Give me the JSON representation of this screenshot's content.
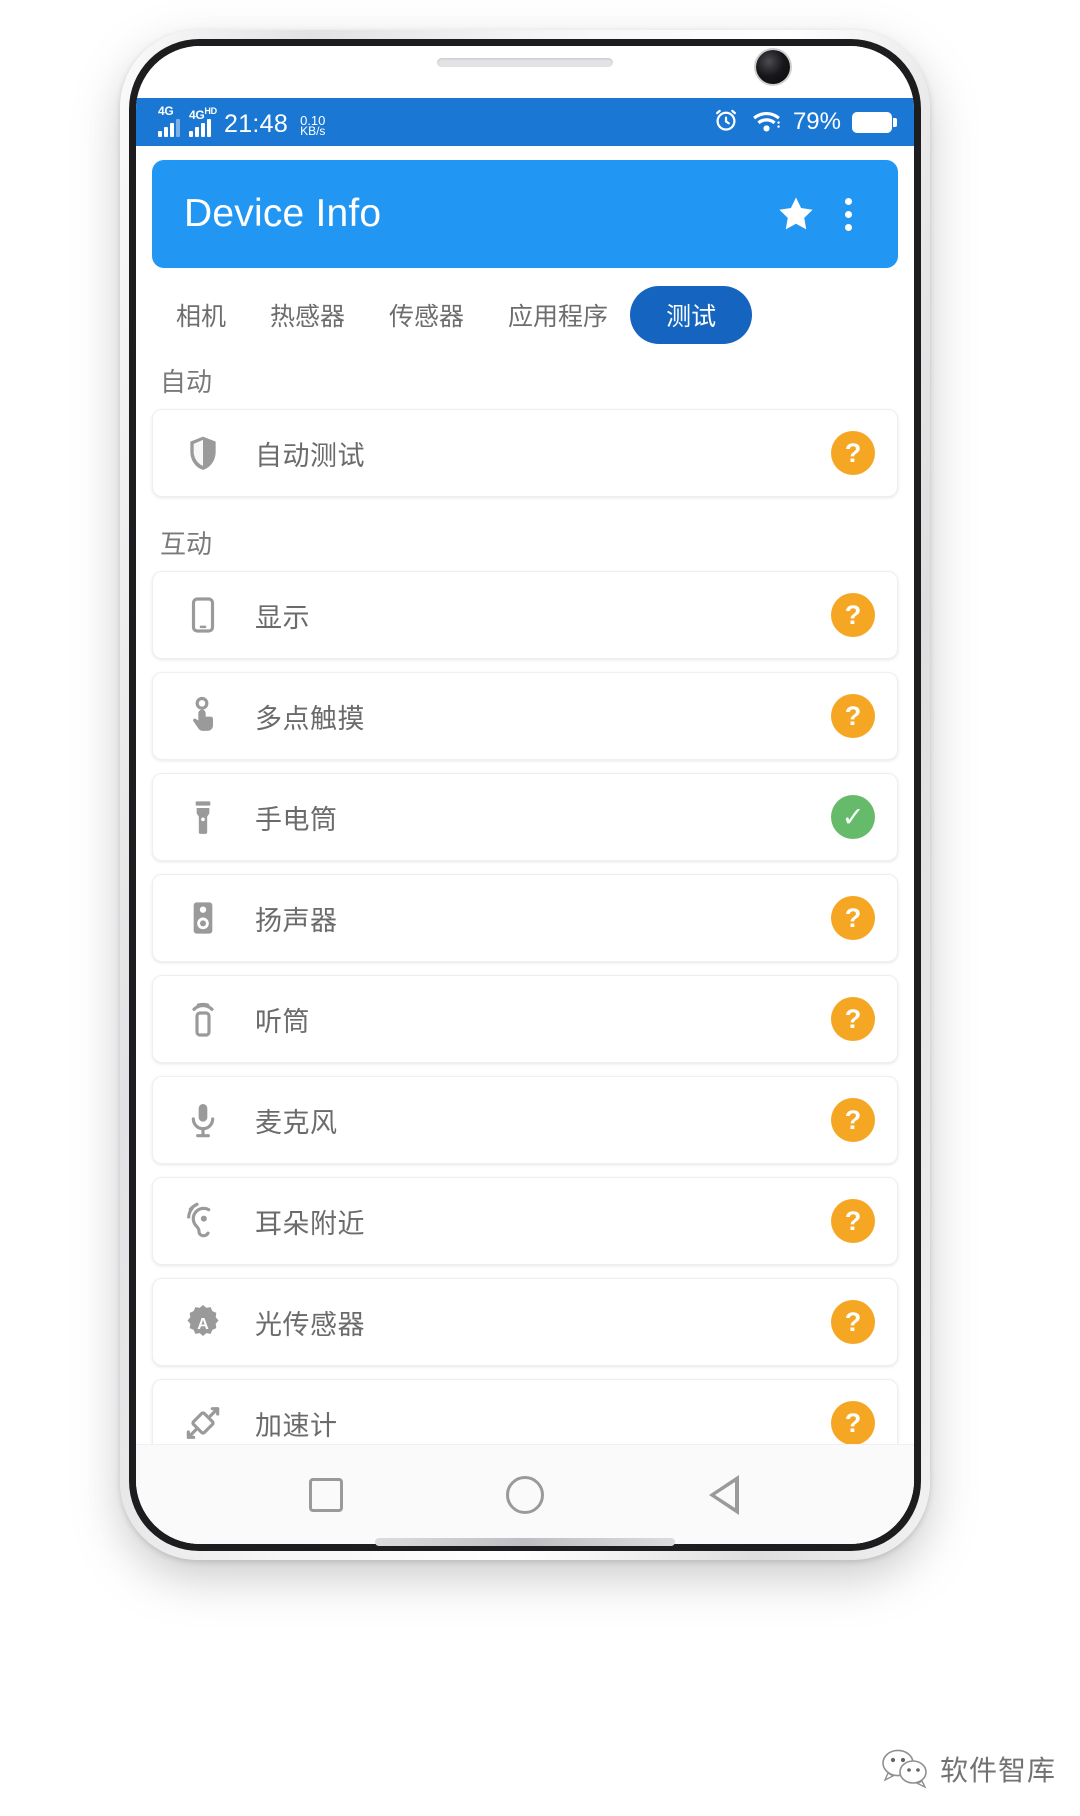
{
  "status_bar": {
    "signal_1_label": "4G",
    "signal_2_label": "4G",
    "signal_2_sup": "HD",
    "clock": "21:48",
    "net_speed_value": "0.10",
    "net_speed_unit": "KB/s",
    "alarm_icon": "alarm-clock-icon",
    "wifi_icon": "wifi-icon",
    "battery_percent": "79%",
    "battery_icon": "battery-full-icon",
    "background_color": "#1b77d4"
  },
  "app_bar": {
    "title": "Device Info",
    "star_icon": "star-icon",
    "overflow_icon": "more-vertical-icon",
    "accent_color": "#2196f3"
  },
  "tabs": [
    {
      "label": "相机",
      "selected": false
    },
    {
      "label": "热感器",
      "selected": false
    },
    {
      "label": "传感器",
      "selected": false
    },
    {
      "label": "应用程序",
      "selected": false
    },
    {
      "label": "测试",
      "selected": true
    }
  ],
  "tab_selected_color": "#1565c0",
  "sections": [
    {
      "label": "自动",
      "items": [
        {
          "name": "自动测试",
          "icon": "shield-icon",
          "status": "unknown",
          "status_glyph": "?"
        }
      ]
    },
    {
      "label": "互动",
      "items": [
        {
          "name": "显示",
          "icon": "smartphone-icon",
          "status": "unknown",
          "status_glyph": "?"
        },
        {
          "name": "多点触摸",
          "icon": "touch-finger-icon",
          "status": "unknown",
          "status_glyph": "?"
        },
        {
          "name": "手电筒",
          "icon": "flashlight-icon",
          "status": "pass",
          "status_glyph": "✓"
        },
        {
          "name": "扬声器",
          "icon": "speaker-icon",
          "status": "unknown",
          "status_glyph": "?"
        },
        {
          "name": "听筒",
          "icon": "earpiece-icon",
          "status": "unknown",
          "status_glyph": "?"
        },
        {
          "name": "麦克风",
          "icon": "microphone-icon",
          "status": "unknown",
          "status_glyph": "?"
        },
        {
          "name": "耳朵附近",
          "icon": "ear-proximity-icon",
          "status": "unknown",
          "status_glyph": "?"
        },
        {
          "name": "光传感器",
          "icon": "light-sensor-icon",
          "status": "unknown",
          "status_glyph": "?"
        },
        {
          "name": "加速计",
          "icon": "accelerometer-icon",
          "status": "unknown",
          "status_glyph": "?"
        }
      ]
    }
  ],
  "status_colors": {
    "unknown": "#f5a623",
    "pass": "#66bb6a"
  },
  "nav_bar": {
    "recents_icon": "square-recents-icon",
    "home_icon": "circle-home-icon",
    "back_icon": "triangle-back-icon"
  },
  "watermark": {
    "text": "软件智库",
    "icon": "wechat-icon"
  }
}
